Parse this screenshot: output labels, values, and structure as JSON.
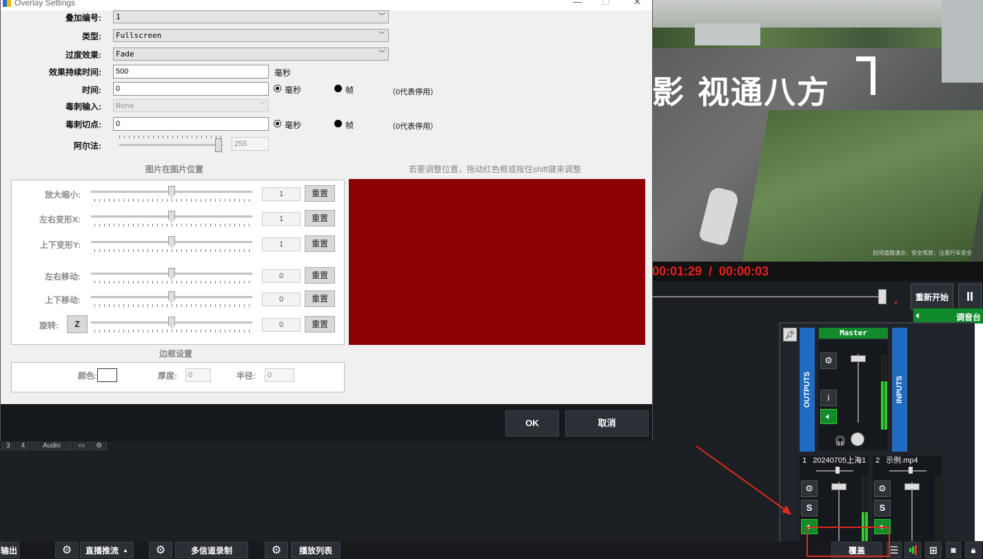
{
  "dialog": {
    "title": "Overlay Settings",
    "fields": {
      "overlay_no_label": "叠加编号:",
      "overlay_no_value": "1",
      "type_label": "类型:",
      "type_value": "Fullscreen",
      "transition_label": "过度效果:",
      "transition_value": "Fade",
      "duration_label": "效果持续时间:",
      "duration_value": "500",
      "duration_unit": "毫秒",
      "time_label": "时间:",
      "time_value": "0",
      "unit_ms": "毫秒",
      "unit_frame": "帧",
      "disabled_hint": "（0代表停用）",
      "stinger_input_label": "毒刺输入:",
      "stinger_input_value": "None",
      "stinger_cut_label": "毒刺切点:",
      "stinger_cut_value": "0",
      "alpha_label": "阿尔法:",
      "alpha_value": "255"
    },
    "pip": {
      "section_title": "图片在图片位置",
      "hint": "若要调整位置，拖动红色框或按住shift键来调整",
      "rows": [
        {
          "label": "放大缩小:",
          "value": "1",
          "reset": "重置"
        },
        {
          "label": "左右变形X:",
          "value": "1",
          "reset": "重置"
        },
        {
          "label": "上下变形Y:",
          "value": "1",
          "reset": "重置"
        },
        {
          "label": "左右移动:",
          "value": "0",
          "reset": "重置"
        },
        {
          "label": "上下移动:",
          "value": "0",
          "reset": "重置"
        },
        {
          "label": "旋转:",
          "value": "0",
          "reset": "重置"
        }
      ],
      "rotate_z": "Z",
      "preview_color": "#8b0000"
    },
    "border": {
      "section_title": "边框设置",
      "color_label": "颜色:",
      "thickness_label": "厚度:",
      "thickness_value": "0",
      "radius_label": "半径:",
      "radius_value": "0"
    },
    "ok": "OK",
    "cancel": "取消"
  },
  "video": {
    "overlay_text": "影 视通八方",
    "small_text": "封闭道路演示，安全驾驶，注意行车安全",
    "timecode": "00:01:29  /  00:00:03",
    "restart": "重新开始",
    "pause": "II",
    "mixer_label": "调音台"
  },
  "mixer": {
    "outputs": "OUTPUTS",
    "inputs": "INPUTS",
    "master": "Master",
    "info_btn": "i",
    "channels": [
      {
        "num": "1",
        "name": "20240705上海1",
        "solo": "S"
      },
      {
        "num": "2",
        "name": "示例.mp4",
        "solo": "S"
      }
    ]
  },
  "tabs": [
    "3",
    "4",
    "Audio"
  ],
  "toolbar": {
    "output": "输出",
    "stream": "直播推流",
    "record": "多信道录制",
    "playlist": "播放列表",
    "overlay": "覆盖"
  }
}
